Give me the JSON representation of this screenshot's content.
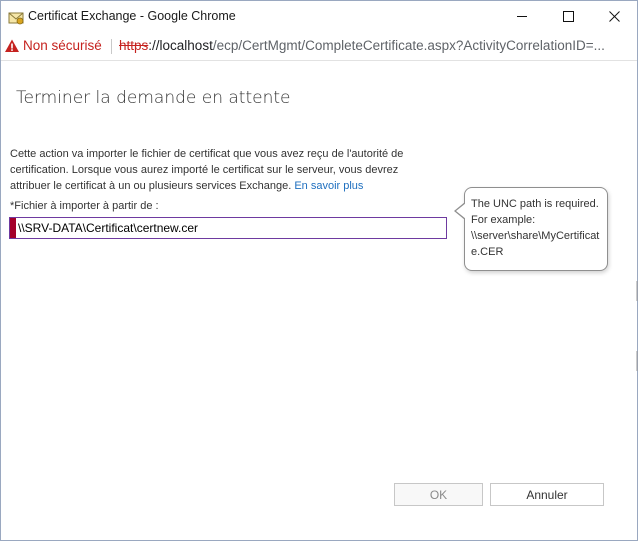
{
  "window": {
    "title": "Certificat Exchange - Google Chrome"
  },
  "addressbar": {
    "security_text": "Non sécurisé",
    "url_protocol": "https",
    "url_host": "://localhost",
    "url_path": "/ecp/CertMgmt/CompleteCertificate.aspx?ActivityCorrelationID=..."
  },
  "page": {
    "title": "Terminer la demande en attente",
    "description": "Cette action va importer le fichier de certificat que vous avez reçu de l'autorité de certification. Lorsque vous aurez importé le certificat sur le serveur, vous devrez attribuer le certificat à un ou plusieurs services Exchange.",
    "learn_more": "En savoir plus",
    "field_label": "*Fichier à importer à partir de :",
    "field_value": "\\\\SRV-DATA\\Certificat\\certnew.cer"
  },
  "tooltip": {
    "lines": [
      "The UNC path is required.",
      "For example:",
      "\\\\server\\share\\MyCertificat",
      "e.CER"
    ]
  },
  "buttons": {
    "ok": "OK",
    "cancel": "Annuler"
  },
  "colors": {
    "error_accent": "#a4002a",
    "input_border": "#6e3aa0",
    "link": "#1e6fbf",
    "insecure": "#c5221f"
  },
  "icons": {
    "app": "envelope-certificate-icon",
    "security": "warning-triangle-icon",
    "minimize": "minimize-icon",
    "maximize": "maximize-icon",
    "close": "close-icon"
  }
}
